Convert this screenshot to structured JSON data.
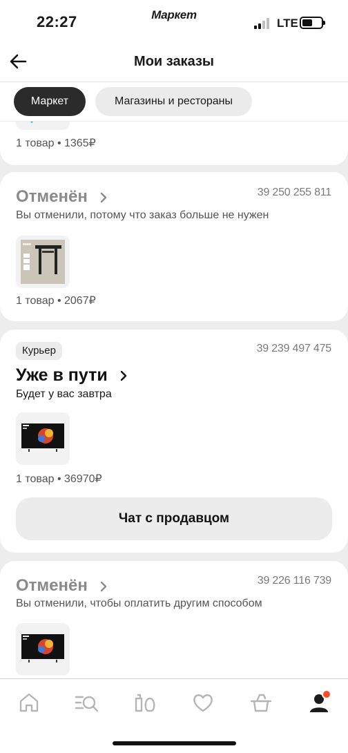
{
  "status_bar": {
    "time": "22:27",
    "app_name": "Маркет",
    "network": "LTE"
  },
  "header": {
    "title": "Мои заказы"
  },
  "tabs": [
    {
      "label": "Маркет",
      "active": true
    },
    {
      "label": "Магазины и рестораны",
      "active": false
    }
  ],
  "orders": [
    {
      "summary": "1 товар • 1365₽"
    },
    {
      "status": "Отменён",
      "number": "39 250 255 811",
      "note": "Вы отменили, потому что заказ больше не нужен",
      "summary": "1 товар • 2067₽",
      "image": "tv-wall-mount"
    },
    {
      "delivery_chip": "Курьер",
      "status": "Уже в пути",
      "number": "39 239 497 475",
      "note": "Будет у вас завтра",
      "summary": "1 товар • 36970₽",
      "image": "tcl-tv",
      "button": "Чат с продавцом"
    },
    {
      "status": "Отменён",
      "number": "39 226 116 739",
      "note": "Вы отменили, чтобы оплатить другим способом",
      "image": "tcl-tv"
    }
  ],
  "bottom_nav": [
    {
      "icon": "home-icon",
      "active": false
    },
    {
      "icon": "catalog-search-icon",
      "active": false
    },
    {
      "icon": "products-icon",
      "active": false
    },
    {
      "icon": "heart-icon",
      "active": false
    },
    {
      "icon": "cart-icon",
      "active": false
    },
    {
      "icon": "profile-icon",
      "active": true,
      "badge": true
    }
  ],
  "colors": {
    "accent": "#2b2b2b",
    "badge": "#ff4b2b",
    "background": "#ededed"
  }
}
